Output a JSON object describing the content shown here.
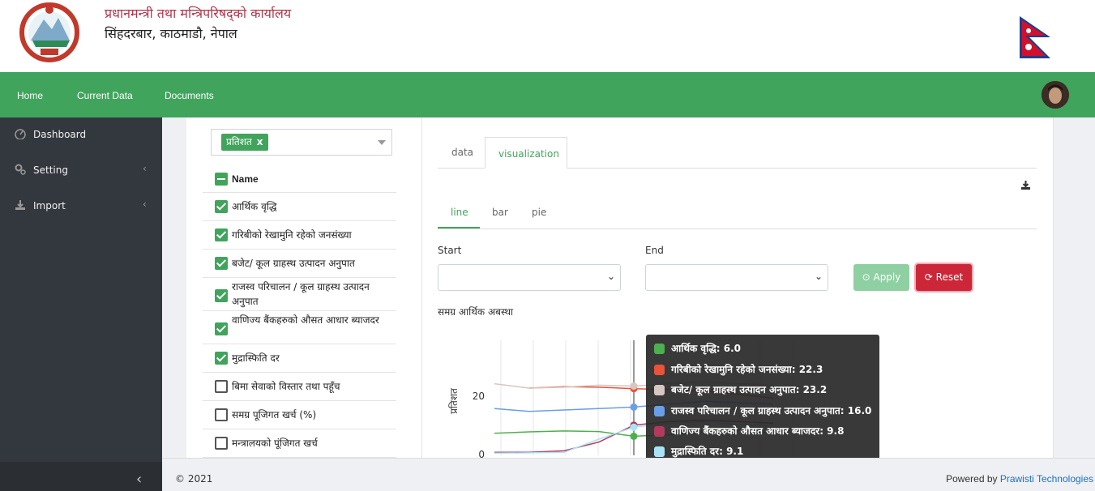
{
  "header": {
    "org_name": "प्रधानमन्त्री तथा मन्त्रिपरिषद्को कार्यालय",
    "org_address": "सिंहदरबार, काठमाडौ, नेपाल"
  },
  "topnav": {
    "items": [
      "Home",
      "Current Data",
      "Documents"
    ]
  },
  "sidebar": {
    "items": [
      {
        "label": "Dashboard",
        "icon": "dashboard-icon"
      },
      {
        "label": "Setting",
        "icon": "cogs-icon"
      },
      {
        "label": "Import",
        "icon": "download-icon"
      }
    ]
  },
  "filter": {
    "selected_tag": "प्रतिशत",
    "tag_remove": "x",
    "header_label": "Name",
    "rows": [
      {
        "label": "आर्थिक वृद्धि",
        "checked": true
      },
      {
        "label": "गरिबीको रेखामुनि रहेको जनसंख्या",
        "checked": true
      },
      {
        "label": "बजेट/ कूल ग्राहस्थ उत्पादन अनुपात",
        "checked": true
      },
      {
        "label": "राजस्व परिचालन / कूल ग्राहस्थ उत्पादन अनुपात",
        "checked": true
      },
      {
        "label": "वाणिज्य बैंकहरुको औसत आधार ब्याजदर",
        "checked": true
      },
      {
        "label": "मुद्रास्फिति दर",
        "checked": true
      },
      {
        "label": "बिमा सेवाको विस्तार तथा पहूँच",
        "checked": false
      },
      {
        "label": "समग्र पूजिगत खर्च (%)",
        "checked": false
      },
      {
        "label": "मन्त्रालयको पूंजिगत खर्च",
        "checked": false
      }
    ]
  },
  "tabs": {
    "items": [
      "data",
      "visualization"
    ],
    "active": "visualization"
  },
  "subtabs": {
    "items": [
      "line",
      "bar",
      "pie"
    ],
    "active": "line"
  },
  "form": {
    "start_label": "Start",
    "end_label": "End",
    "start_value": "",
    "end_value": "",
    "apply_label": "Apply",
    "reset_label": "Reset"
  },
  "chart_data": {
    "type": "line",
    "title": "समग्र आर्थिक अबस्था",
    "ylabel": "प्रतिशत",
    "xlabel": "",
    "yticks": [
      "0",
      "20"
    ],
    "grid": true,
    "series": [
      {
        "name": "आर्थिक वृद्धि",
        "color": "#4caf50",
        "hover_value": 6.0
      },
      {
        "name": "गरिबीको रेखामुनि रहेको जनसंख्या",
        "color": "#e8533a",
        "hover_value": 22.3
      },
      {
        "name": "बजेट/ कूल ग्राहस्थ उत्पादन अनुपात",
        "color": "#d7c6c2",
        "hover_value": 23.2
      },
      {
        "name": "राजस्व परिचालन / कूल ग्राहस्थ उत्पादन अनुपात",
        "color": "#6a9ee6",
        "hover_value": 16.0
      },
      {
        "name": "वाणिज्य बैंकहरुको औसत आधार ब्याजदर",
        "color": "#b33a5e",
        "hover_value": 9.8
      },
      {
        "name": "मुद्रास्फिति दर",
        "color": "#a9e3f5",
        "hover_value": 9.1
      }
    ]
  },
  "tooltip": {
    "rows": [
      "आर्थिक वृद्धि: 6.0",
      "गरिबीको रेखामुनि रहेको जनसंख्या: 22.3",
      "बजेट/ कूल ग्राहस्थ उत्पादन अनुपात: 23.2",
      "राजस्व परिचालन / कूल ग्राहस्थ उत्पादन अनुपात: 16.0",
      "वाणिज्य बैंकहरुको औसत आधार ब्याजदर: 9.8",
      "मुद्रास्फिति दर: 9.1"
    ]
  },
  "footer": {
    "copyright": "© 2021",
    "powered_prefix": "Powered by ",
    "powered_company": "Prawisti Technologies"
  },
  "colors": {
    "brand_green": "#41a45c",
    "sidebar_bg": "#33373e",
    "reset_red": "#cc2639",
    "apply_green_disabled": "#8fd0a2"
  }
}
